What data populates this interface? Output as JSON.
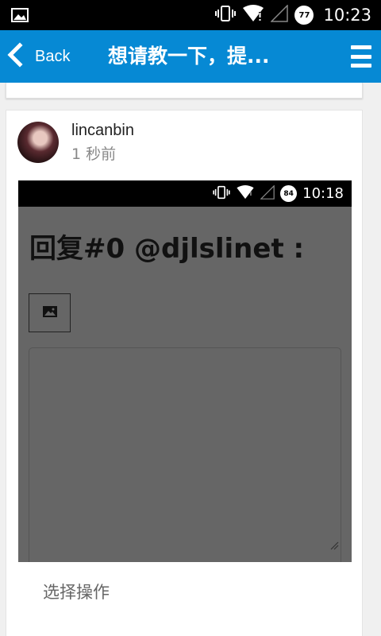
{
  "status_bar": {
    "time": "10:23",
    "battery_level": "77",
    "icons": [
      "image-icon",
      "vibrate-icon",
      "wifi-icon",
      "signal-icon",
      "battery-icon"
    ]
  },
  "action_bar": {
    "back_label": "Back",
    "title": "想请教一下，提...",
    "background_color": "#0689d4"
  },
  "post": {
    "username": "lincanbin",
    "timestamp": "1 秒前",
    "embedded_screenshot": {
      "time": "10:18",
      "battery_level": "84",
      "heading": "回复#0 @djlslinet :"
    }
  },
  "footer": {
    "select_action_label": "选择操作"
  }
}
